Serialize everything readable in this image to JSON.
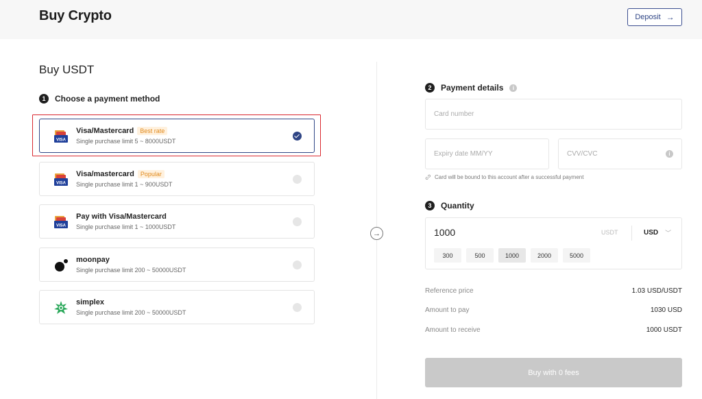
{
  "header": {
    "title": "Buy Crypto",
    "deposit_label": "Deposit",
    "deposit_arrow": "→"
  },
  "left": {
    "section_title": "Buy USDT",
    "step1": {
      "num": "1",
      "label": "Choose a payment method"
    },
    "methods": [
      {
        "name": "Visa/Mastercard",
        "badge": "Best rate",
        "limit": "Single purchase limit 5 ~ 8000USDT",
        "icon": "visa-card-icon",
        "selected": true
      },
      {
        "name": "Visa/mastercard",
        "badge": "Popular",
        "limit": "Single purchase limit 1 ~ 900USDT",
        "icon": "visa-card-icon",
        "selected": false
      },
      {
        "name": "Pay with Visa/Mastercard",
        "badge": "",
        "limit": "Single purchase limit 1 ~ 1000USDT",
        "icon": "visa-card-icon",
        "selected": false
      },
      {
        "name": "moonpay",
        "badge": "",
        "limit": "Single purchase limit 200 ~ 50000USDT",
        "icon": "moonpay-icon",
        "selected": false
      },
      {
        "name": "simplex",
        "badge": "",
        "limit": "Single purchase limit 200 ~ 50000USDT",
        "icon": "simplex-icon",
        "selected": false
      }
    ]
  },
  "right": {
    "step2": {
      "num": "2",
      "label": "Payment details"
    },
    "card_number_placeholder": "Card number",
    "expiry_placeholder": "Expiry date MM/YY",
    "cvv_placeholder": "CVV/CVC",
    "bind_note": "Card will be bound to this account after a successful payment",
    "step3": {
      "num": "3",
      "label": "Quantity"
    },
    "quantity": {
      "value": "1000",
      "unit": "USDT",
      "currency": "USD",
      "chips": [
        "300",
        "500",
        "1000",
        "2000",
        "5000"
      ],
      "active_chip": "1000"
    },
    "summary": [
      {
        "label": "Reference price",
        "value": "1.03 USD/USDT"
      },
      {
        "label": "Amount to pay",
        "value": "1030 USD"
      },
      {
        "label": "Amount to receive",
        "value": "1000 USDT"
      }
    ],
    "buy_label": "Buy with 0 fees"
  },
  "colors": {
    "accent": "#2f4585",
    "highlight": "#d9272e",
    "badge_text": "#e08a1e",
    "disabled_button": "#c9c9c9"
  }
}
